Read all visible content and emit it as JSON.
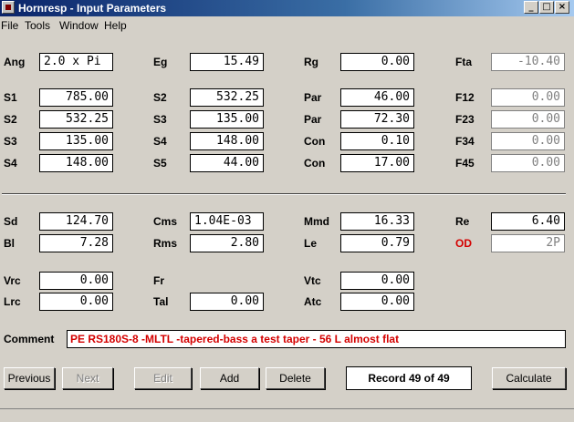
{
  "window": {
    "title": "Hornresp - Input Parameters"
  },
  "menu": {
    "items": [
      "File",
      "Tools",
      "Window",
      "Help"
    ]
  },
  "row1": {
    "ang_label": "Ang",
    "ang_value": "2.0 x Pi",
    "eg_label": "Eg",
    "eg_value": "15.49",
    "rg_label": "Rg",
    "rg_value": "0.00",
    "fta_label": "Fta",
    "fta_value": "-10.40"
  },
  "horn": [
    {
      "s_label": "S1",
      "s_value": "785.00",
      "s2_label": "S2",
      "s2_value": "532.25",
      "p_label": "Par",
      "p_value": "46.00",
      "f_label": "F12",
      "f_value": "0.00"
    },
    {
      "s_label": "S2",
      "s_value": "532.25",
      "s2_label": "S3",
      "s2_value": "135.00",
      "p_label": "Par",
      "p_value": "72.30",
      "f_label": "F23",
      "f_value": "0.00"
    },
    {
      "s_label": "S3",
      "s_value": "135.00",
      "s2_label": "S4",
      "s2_value": "148.00",
      "p_label": "Con",
      "p_value": "0.10",
      "f_label": "F34",
      "f_value": "0.00"
    },
    {
      "s_label": "S4",
      "s_value": "148.00",
      "s2_label": "S5",
      "s2_value": "44.00",
      "p_label": "Con",
      "p_value": "17.00",
      "f_label": "F45",
      "f_value": "0.00"
    }
  ],
  "driver": {
    "sd_label": "Sd",
    "sd_value": "124.70",
    "cms_label": "Cms",
    "cms_value": "1.04E-03",
    "mmd_label": "Mmd",
    "mmd_value": "16.33",
    "re_label": "Re",
    "re_value": "6.40",
    "bl_label": "Bl",
    "bl_value": "7.28",
    "rms_label": "Rms",
    "rms_value": "2.80",
    "le_label": "Le",
    "le_value": "0.79",
    "od_label": "OD",
    "od_value": "2P"
  },
  "chambers": {
    "vrc_label": "Vrc",
    "vrc_value": "0.00",
    "fr_label": "Fr",
    "fr_value": "",
    "vtc_label": "Vtc",
    "vtc_value": "0.00",
    "lrc_label": "Lrc",
    "lrc_value": "0.00",
    "tal_label": "Tal",
    "tal_value": "0.00",
    "atc_label": "Atc",
    "atc_value": "0.00"
  },
  "comment": {
    "label": "Comment",
    "value": "PE RS180S-8 -MLTL -tapered-bass a test taper - 56 L almost flat"
  },
  "buttons": {
    "previous": "Previous",
    "next": "Next",
    "edit": "Edit",
    "add": "Add",
    "delete": "Delete",
    "calculate": "Calculate"
  },
  "record": "Record 49 of 49",
  "colors": {
    "title_bar": "#0a246a",
    "accent_red": "#d40000",
    "face": "#d4d0c8"
  }
}
